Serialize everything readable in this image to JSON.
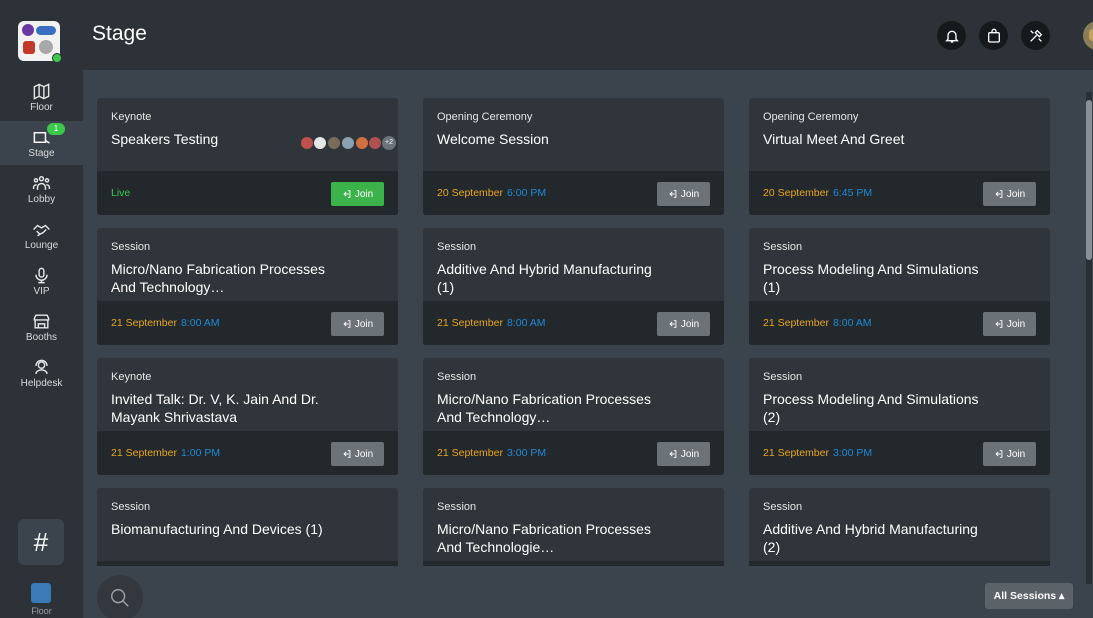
{
  "app": {
    "page_title": "Stage"
  },
  "sidebar": {
    "items": [
      {
        "label": "Floor",
        "icon": "map-icon"
      },
      {
        "label": "Stage",
        "icon": "stage-icon",
        "badge": "1",
        "active": true
      },
      {
        "label": "Lobby",
        "icon": "people-icon"
      },
      {
        "label": "Lounge",
        "icon": "handshake-icon"
      },
      {
        "label": "VIP",
        "icon": "microphone-icon"
      },
      {
        "label": "Booths",
        "icon": "booth-icon"
      },
      {
        "label": "Helpdesk",
        "icon": "support-agent-icon"
      }
    ],
    "hash_label": "#",
    "footer_label": "Floor"
  },
  "header": {
    "icons": [
      "bell-icon",
      "shopping-bag-icon",
      "tools-icon",
      "user-avatar"
    ]
  },
  "sessions": [
    {
      "category": "Keynote",
      "title": "Speakers Testing",
      "status": "Live",
      "join": "Join",
      "speakers_more": "+2"
    },
    {
      "category": "Opening Ceremony",
      "title": "Welcome Session",
      "date": "20 September",
      "time": "6:00 PM",
      "join": "Join"
    },
    {
      "category": "Opening Ceremony",
      "title": "Virtual Meet And Greet",
      "date": "20 September",
      "time": "6:45 PM",
      "join": "Join"
    },
    {
      "category": "Session",
      "title": "Micro/Nano Fabrication Processes And Technology…",
      "date": "21 September",
      "time": "8:00 AM",
      "join": "Join"
    },
    {
      "category": "Session",
      "title": "Additive And Hybrid Manufacturing (1)",
      "date": "21 September",
      "time": "8:00 AM",
      "join": "Join"
    },
    {
      "category": "Session",
      "title": "Process Modeling And Simulations (1)",
      "date": "21 September",
      "time": "8:00 AM",
      "join": "Join"
    },
    {
      "category": "Keynote",
      "title": "Invited Talk: Dr. V, K. Jain And Dr. Mayank Shrivastava",
      "date": "21 September",
      "time": "1:00 PM",
      "join": "Join"
    },
    {
      "category": "Session",
      "title": "Micro/Nano Fabrication Processes And Technology…",
      "date": "21 September",
      "time": "3:00 PM",
      "join": "Join"
    },
    {
      "category": "Session",
      "title": "Process Modeling And Simulations (2)",
      "date": "21 September",
      "time": "3:00 PM",
      "join": "Join"
    },
    {
      "category": "Session",
      "title": "Biomanufacturing And Devices (1)"
    },
    {
      "category": "Session",
      "title": "Micro/Nano Fabrication Processes And Technologie…"
    },
    {
      "category": "Session",
      "title": "Additive And Hybrid Manufacturing (2)"
    }
  ],
  "footer": {
    "filter_label": "All Sessions ▴"
  },
  "colors": {
    "date": "#e8a521",
    "time": "#1f8ad6",
    "live": "#3cc84d",
    "join_live_bg": "#3cb34a",
    "join_bg": "#6b7379"
  }
}
